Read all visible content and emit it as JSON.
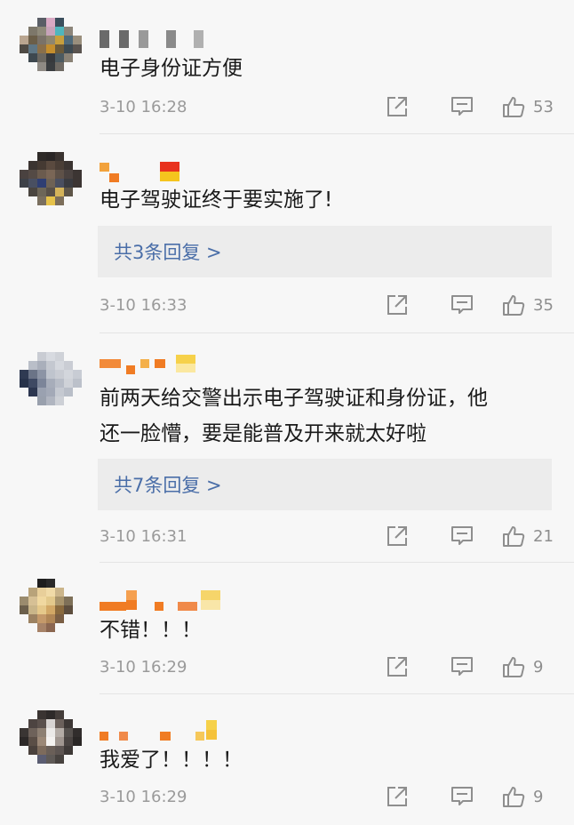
{
  "comments": [
    {
      "text": "电子身份证方便",
      "time": "3-10 16:28",
      "likes": "53",
      "reply": ""
    },
    {
      "text": "电子驾驶证终于要实施了!",
      "time": "3-10 16:33",
      "likes": "35",
      "reply": "共3条回复 >"
    },
    {
      "text": "前两天给交警出示电子驾驶证和身份证，他\n还一脸懵，要是能普及开来就太好啦",
      "time": "3-10 16:31",
      "likes": "21",
      "reply": "共7条回复 >"
    },
    {
      "text": "不错！！！",
      "time": "3-10 16:29",
      "likes": "9",
      "reply": ""
    },
    {
      "text": "我爱了！！！！",
      "time": "3-10 16:29",
      "likes": "9",
      "reply": ""
    }
  ],
  "icons": {
    "share": "share-icon",
    "comment": "comment-icon",
    "like": "thumbs-up-icon"
  },
  "colors": {
    "reply_link": "#4a6ea8",
    "background": "#f7f7f7",
    "reply_box": "#ececec",
    "meta": "#9a9a9a"
  }
}
